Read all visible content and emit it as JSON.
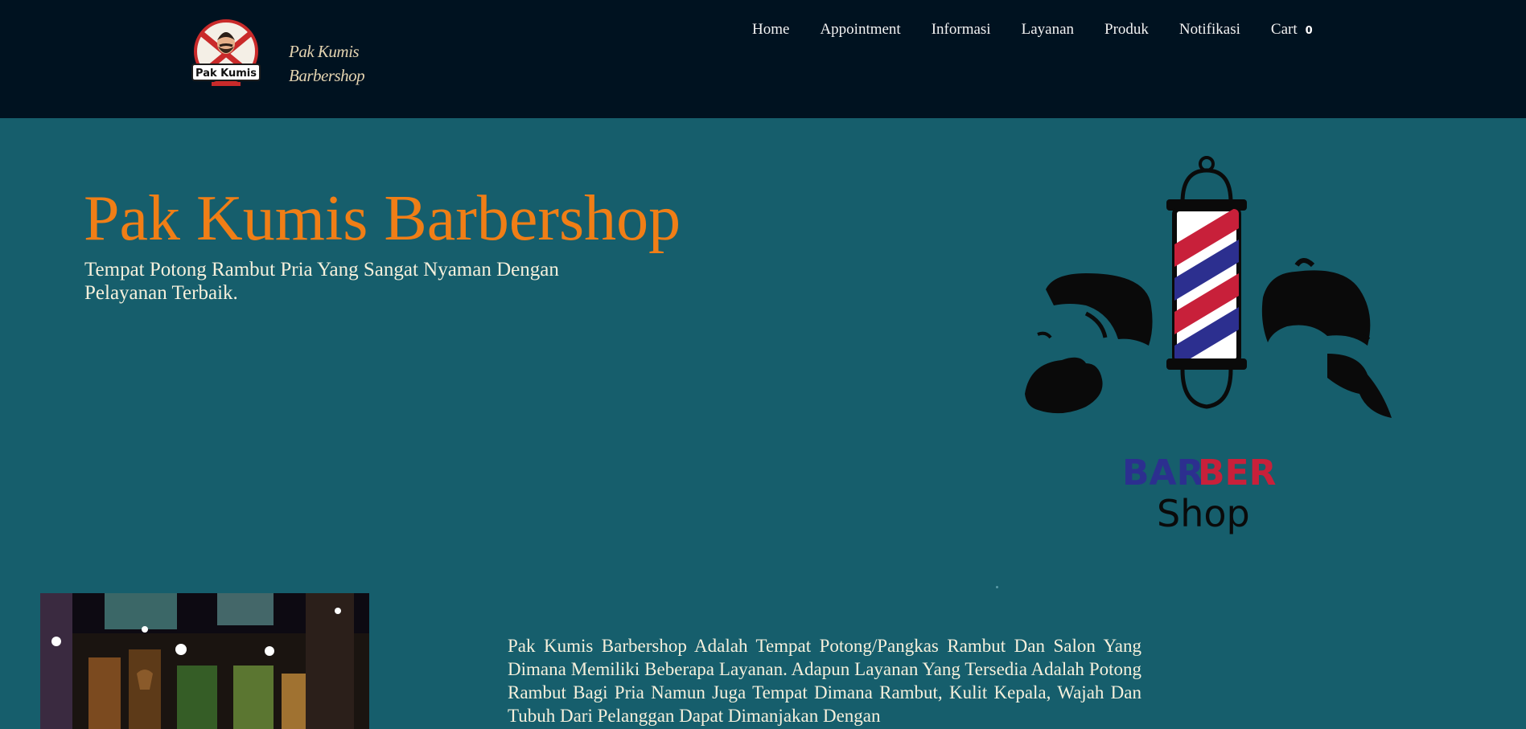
{
  "brand": {
    "badge_text": "Pak Kumis",
    "name_line1": "Pak Kumis",
    "name_line2": "Barbershop"
  },
  "nav": {
    "items": [
      "Home",
      "Appointment",
      "Informasi",
      "Layanan",
      "Produk",
      "Notifikasi"
    ],
    "cart_label": "Cart",
    "cart_count": "0"
  },
  "hero": {
    "title": "Pak Kumis Barbershop",
    "subtitle": "Tempat Potong Rambut Pria Yang Sangat Nyaman Dengan Pelayanan Terbaik.",
    "art_word1_part1": "BAR",
    "art_word1_part2": "BER",
    "art_word2": "Shop"
  },
  "about": {
    "text": "Pak Kumis Barbershop Adalah Tempat Potong/Pangkas Rambut Dan Salon Yang Dimana Memiliki Beberapa Layanan. Adapun Layanan Yang Tersedia Adalah Potong Rambut Bagi Pria Namun Juga Tempat Dimana Rambut, Kulit Kepala, Wajah Dan Tubuh Dari Pelanggan Dapat Dimanjakan Dengan"
  },
  "colors": {
    "header_bg": "#001220",
    "page_bg": "#165e6c",
    "title_orange": "#f07e16",
    "text_cream": "#f5f0dc",
    "pole_red": "#c8203a",
    "pole_blue": "#2c2f8f"
  }
}
